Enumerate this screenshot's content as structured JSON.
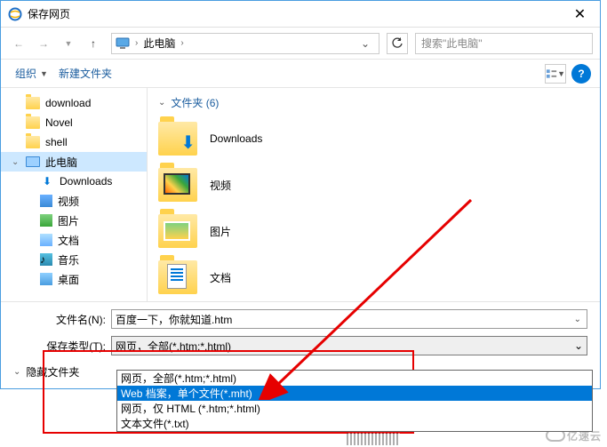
{
  "titlebar": {
    "title": "保存网页"
  },
  "nav": {
    "breadcrumb": "此电脑",
    "search_placeholder": "搜索\"此电脑\""
  },
  "toolbar": {
    "organize": "组织",
    "new_folder": "新建文件夹"
  },
  "tree": {
    "items": [
      {
        "label": "download",
        "type": "folder"
      },
      {
        "label": "Novel",
        "type": "folder"
      },
      {
        "label": "shell",
        "type": "folder"
      },
      {
        "label": "此电脑",
        "type": "pc",
        "selected": true
      },
      {
        "label": "Downloads",
        "type": "dl",
        "lvl": 2
      },
      {
        "label": "视频",
        "type": "video",
        "lvl": 2
      },
      {
        "label": "图片",
        "type": "pic",
        "lvl": 2
      },
      {
        "label": "文档",
        "type": "doc",
        "lvl": 2
      },
      {
        "label": "音乐",
        "type": "music",
        "lvl": 2
      },
      {
        "label": "桌面",
        "type": "desktop",
        "lvl": 2
      }
    ]
  },
  "content": {
    "group_label": "文件夹 (6)",
    "items": [
      {
        "label": "Downloads",
        "overlay": "dl"
      },
      {
        "label": "视频",
        "overlay": "vid"
      },
      {
        "label": "图片",
        "overlay": "pic"
      },
      {
        "label": "文档",
        "overlay": "doc"
      }
    ]
  },
  "form": {
    "filename_label": "文件名(N):",
    "filename_value": "百度一下，你就知道.htm",
    "filetype_label": "保存类型(T):",
    "filetype_value": "网页，全部(*.htm;*.html)",
    "hide_folders": "隐藏文件夹"
  },
  "dropdown": {
    "options": [
      "网页，全部(*.htm;*.html)",
      "Web 档案，单个文件(*.mht)",
      "网页，仅 HTML (*.htm;*.html)",
      "文本文件(*.txt)"
    ],
    "selected_index": 1
  },
  "watermark": "亿速云"
}
